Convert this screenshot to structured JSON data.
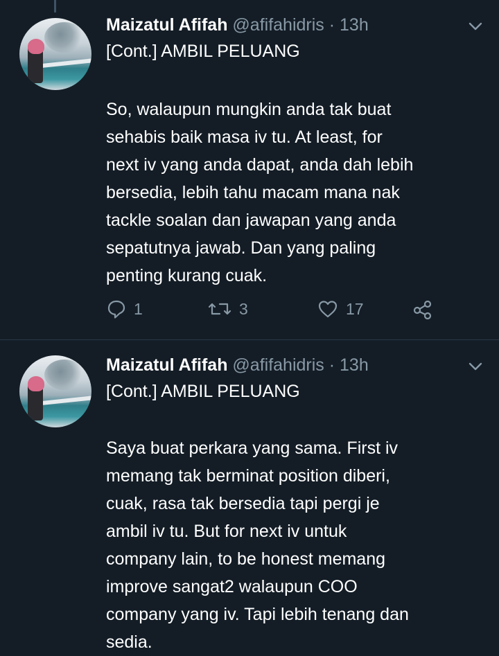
{
  "tweets": [
    {
      "author_name": "Maizatul Afifah",
      "handle_time": "@afifahidris · 13h",
      "tag": "[Cont.] AMBIL PELUANG",
      "lines": [
        "So, walaupun mungkin anda tak buat",
        "sehabis baik masa iv tu. At least, for",
        "next iv yang anda dapat, anda dah lebih",
        "bersedia, lebih tahu macam mana nak",
        "tackle soalan dan jawapan yang anda",
        "sepatutnya jawab. Dan yang paling",
        "penting kurang cuak."
      ],
      "replies": "1",
      "retweets": "3",
      "likes": "17"
    },
    {
      "author_name": "Maizatul Afifah",
      "handle_time": "@afifahidris · 13h",
      "tag": "[Cont.] AMBIL PELUANG",
      "lines": [
        "Saya buat perkara yang sama. First iv",
        "memang tak berminat position diberi,",
        "cuak, rasa tak bersedia tapi pergi je",
        "ambil iv tu. But for next iv untuk",
        "company lain, to be honest memang",
        "improve sangat2 walaupun COO",
        "company yang iv. Tapi lebih tenang dan",
        "sedia."
      ]
    }
  ],
  "colors": {
    "background": "#141d26",
    "text": "#ffffff",
    "secondary": "#8899a6",
    "thread_line": "#3d5466"
  },
  "icons": [
    "chevron-down-icon",
    "reply-icon",
    "retweet-icon",
    "like-icon",
    "share-icon"
  ]
}
